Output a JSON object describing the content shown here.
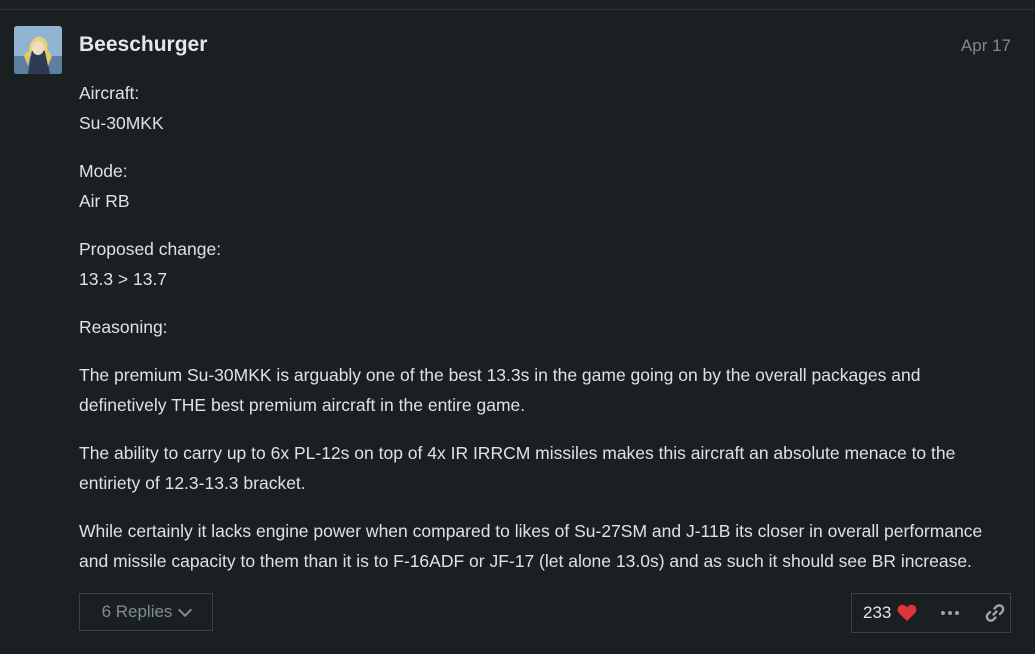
{
  "post": {
    "username": "Beeschurger",
    "date": "Apr 17",
    "paragraphs": [
      {
        "line1": "Aircraft:",
        "line2": "Su-30MKK"
      },
      {
        "line1": "Mode:",
        "line2": "Air RB"
      },
      {
        "line1": "Proposed change:",
        "line2": "13.3 > 13.7"
      },
      {
        "line1": "Reasoning:"
      },
      {
        "line1": "The premium Su-30MKK is arguably one of the best 13.3s in the game going on by the overall packages and",
        "line2": "definetively THE best premium aircraft in the entire game."
      },
      {
        "line1": "The ability to carry up to 6x PL-12s on top of 4x IR IRRCM missiles makes this aircraft an absolute menace to the",
        "line2": "entiriety of 12.3-13.3 bracket."
      },
      {
        "line1": "While certainly it lacks engine power when compared to likes of Su-27SM and J-11B its closer in overall performance",
        "line2": "and missile capacity to them than it is to F-16ADF or JF-17 (let alone 13.0s) and as such it should see BR increase."
      }
    ],
    "replies_label": "6 Replies",
    "like_count": "233",
    "icons": {
      "avatar": "avatar-image",
      "chevron": "chevron-down-icon",
      "heart": "heart-icon",
      "more": "more-ellipsis-icon",
      "link": "link-icon"
    },
    "colors": {
      "heart": "#e0353b",
      "background": "#1a1f22"
    }
  }
}
